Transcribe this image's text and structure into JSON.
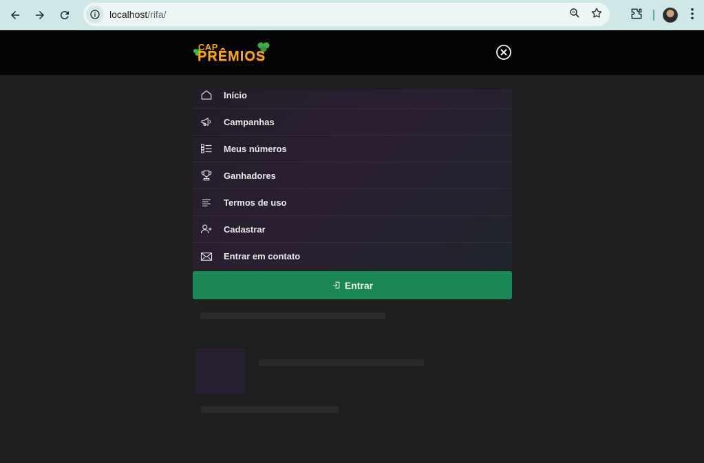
{
  "browser": {
    "url_host": "localhost",
    "url_path": "/rifa/",
    "icons": [
      "back-arrow-icon",
      "forward-arrow-icon",
      "reload-icon",
      "site-info-icon",
      "zoom-icon",
      "bookmark-star-icon",
      "extensions-icon",
      "profile-avatar",
      "kebab-menu-icon"
    ]
  },
  "header": {
    "logo_top": "CAP",
    "logo_main": "PRÊMIOS",
    "close_icon": "close-circle-icon"
  },
  "menu": {
    "items": [
      {
        "label": "Início",
        "icon": "home-icon"
      },
      {
        "label": "Campanhas",
        "icon": "megaphone-icon"
      },
      {
        "label": "Meus números",
        "icon": "checklist-icon"
      },
      {
        "label": "Ganhadores",
        "icon": "trophy-icon"
      },
      {
        "label": "Termos de uso",
        "icon": "text-lines-icon"
      },
      {
        "label": "Cadastrar",
        "icon": "user-plus-icon"
      },
      {
        "label": "Entrar em contato",
        "icon": "envelope-icon"
      }
    ]
  },
  "login_button": {
    "label": "Entrar",
    "icon": "login-icon"
  },
  "colors": {
    "accent_green": "#1a8653",
    "logo_orange": "#f5a623",
    "overlay_bg": "#1f1f1f"
  }
}
